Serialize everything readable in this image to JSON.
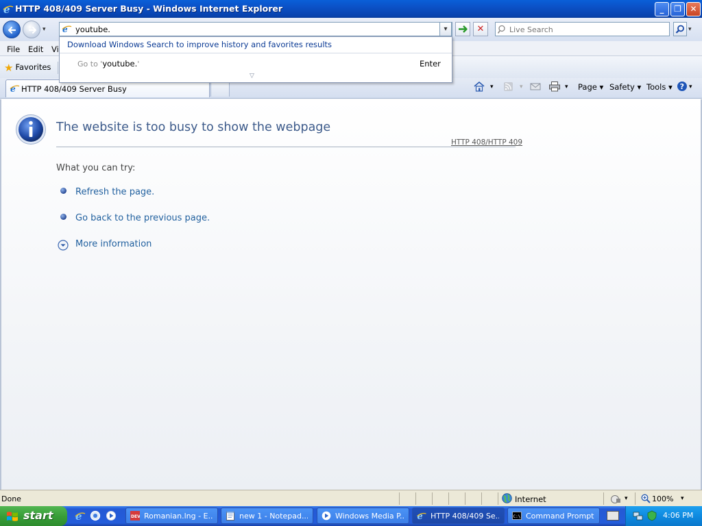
{
  "window": {
    "title": "HTTP 408/409 Server Busy - Windows Internet Explorer",
    "min_label": "_",
    "max_label": "❐",
    "close_label": "✕"
  },
  "address": {
    "value": "youtube.",
    "dropdown_glyph": "▾"
  },
  "search": {
    "placeholder": "Live Search"
  },
  "autocomplete": {
    "promo": "Download Windows Search to improve history and favorites results",
    "goto_prefix": "Go to '",
    "goto_value": "youtube.",
    "goto_suffix": "'",
    "enter": "Enter",
    "more_glyph": "▽"
  },
  "menu": {
    "items": [
      "File",
      "Edit",
      "Vie"
    ]
  },
  "favorites": {
    "label": "Favorites"
  },
  "tab": {
    "label": "HTTP 408/409 Server Busy"
  },
  "command_bar": {
    "page": "Page ▾",
    "safety": "Safety ▾",
    "tools": "Tools ▾",
    "dropdown_glyph": "▾"
  },
  "content": {
    "heading": "The website is too busy to show the webpage",
    "code": "HTTP 408/HTTP 409",
    "try_text": "What you can try:",
    "links": [
      "Refresh the page.",
      "Go back to the previous page."
    ],
    "more_info": "More information"
  },
  "status": {
    "text": "Done",
    "zone": "Internet",
    "zoom": "100%",
    "dropdown_glyph": "▾"
  },
  "taskbar": {
    "start": "start",
    "tasks": [
      "Romanian.lng - E...",
      "new 1 - Notepad...",
      "Windows Media P...",
      "HTTP 408/409 Se...",
      "Command Prompt"
    ],
    "clock": "4:06 PM"
  },
  "colors": {
    "heading": "#3c5a8a",
    "link": "#1f5f9e",
    "titlebar": "#0b4fc4",
    "taskbar": "#245ddb",
    "start": "#389e38"
  }
}
